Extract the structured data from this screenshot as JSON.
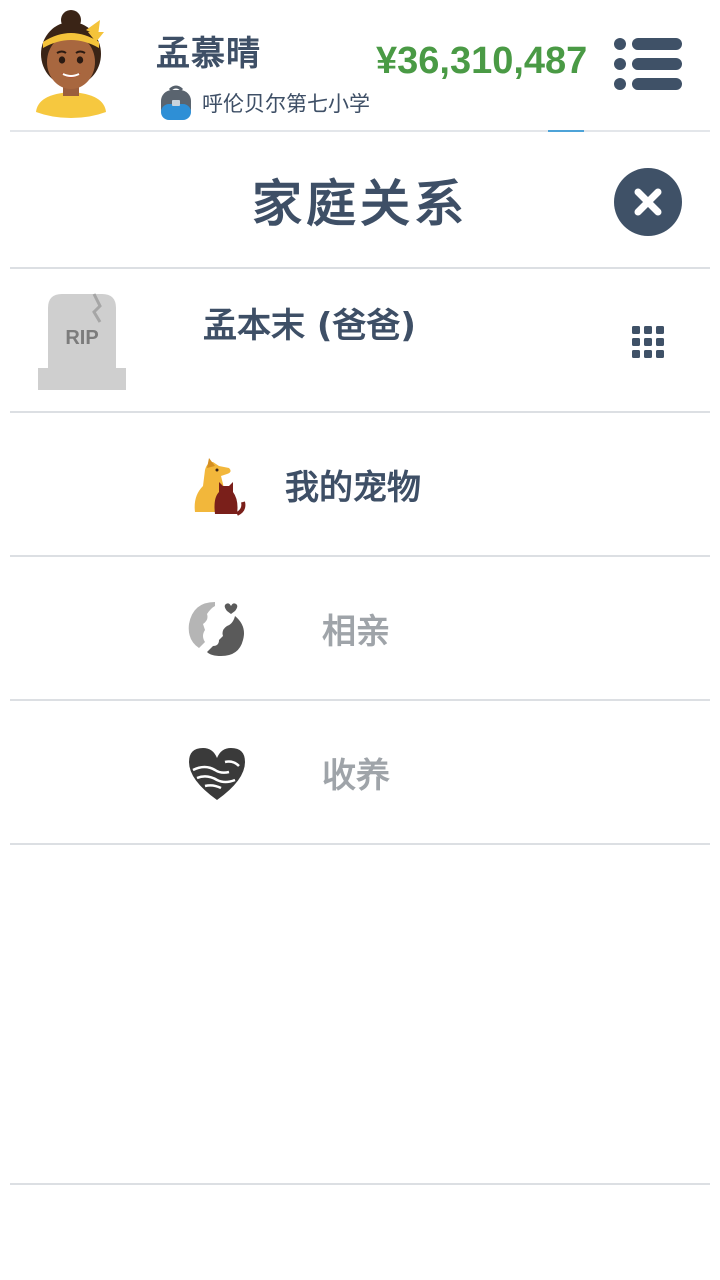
{
  "header": {
    "player_name": "孟慕晴",
    "school": "呼伦贝尔第七小学",
    "money": "¥36,310,487"
  },
  "title": "家庭关系",
  "relative": {
    "name": "孟本末 (爸爸)",
    "tombstone_text": "RIP"
  },
  "options": [
    {
      "label": "我的宠物",
      "icon": "pet-dog-cat-icon",
      "enabled": true
    },
    {
      "label": "相亲",
      "icon": "couple-faces-icon",
      "enabled": false
    },
    {
      "label": "收养",
      "icon": "hands-heart-icon",
      "enabled": false
    }
  ],
  "colors": {
    "money": "#4a9a45",
    "dark_text": "#3e4f66",
    "disabled_text": "#9fa4a9",
    "close_button": "#3f5167",
    "divider": "#dcdfe3"
  }
}
